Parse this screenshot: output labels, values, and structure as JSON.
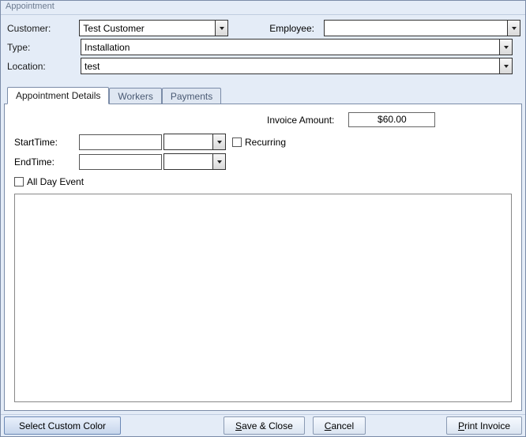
{
  "window": {
    "title": "Appointment"
  },
  "header": {
    "customer_label": "Customer:",
    "customer_value": "Test Customer",
    "employee_label": "Employee:",
    "employee_value": "",
    "type_label": "Type:",
    "type_value": "Installation",
    "location_label": "Location:",
    "location_value": "test"
  },
  "tabs": {
    "t0": "Appointment Details",
    "t1": "Workers",
    "t2": "Payments"
  },
  "details": {
    "invoice_label": "Invoice Amount:",
    "invoice_value": "$60.00",
    "starttime_label": "StartTime:",
    "starttime_date": "",
    "starttime_time": "",
    "endtime_label": "EndTime:",
    "endtime_date": "",
    "endtime_time": "",
    "recurring_label": "Recurring",
    "allday_label": "All Day Event"
  },
  "footer": {
    "select_color": "Select Custom Color",
    "save_close_pre": "S",
    "save_close_post": "ave & Close",
    "cancel_pre": "C",
    "cancel_post": "ancel",
    "print_pre": "P",
    "print_post": "rint Invoice"
  }
}
